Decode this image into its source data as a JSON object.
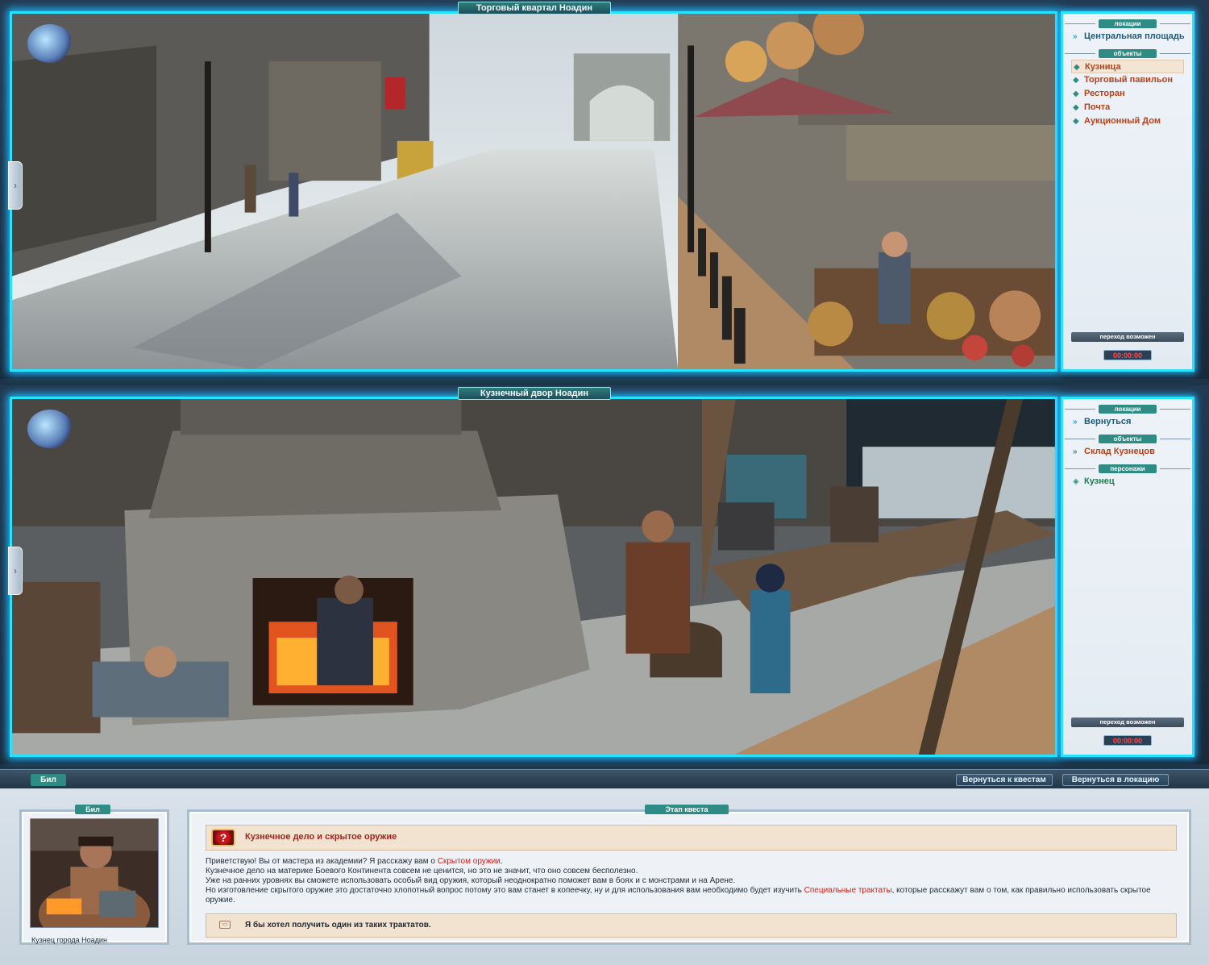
{
  "locations": [
    {
      "title": "Торговый квартал Ноадин",
      "sections": [
        {
          "label": "локации",
          "kind": "loc",
          "items": [
            "Центральная площадь"
          ]
        },
        {
          "label": "объекты",
          "kind": "obj",
          "items": [
            "Кузница",
            "Торговый павильон",
            "Ресторан",
            "Почта",
            "Аукционный Дом"
          ]
        }
      ],
      "transit": "переход возможен",
      "timer": "00:00:00"
    },
    {
      "title": "Кузнечный двор Ноадин",
      "sections": [
        {
          "label": "локации",
          "kind": "loc",
          "items": [
            "Вернуться"
          ]
        },
        {
          "label": "объекты",
          "kind": "obj",
          "items": [
            "Склад Кузнецов"
          ]
        },
        {
          "label": "персонажи",
          "kind": "npc",
          "items": [
            "Кузнец"
          ]
        }
      ],
      "transit": "переход возможен",
      "timer": "00:00:00"
    }
  ],
  "dialog": {
    "npc_tab": "Бил",
    "back_to_quests": "Вернуться к квестам",
    "back_to_location": "Вернуться в локацию",
    "portrait_label": "Бил",
    "portrait_caption": "Кузнец города Ноадин",
    "stage_label": "Этап квеста",
    "quest_title": "Кузнечное дело и скрытое оружие",
    "text": {
      "l1_a": "Приветствую! Вы от мастера из академии? Я расскажу вам о ",
      "l1_hl": "Скрытом оружии",
      "l1_b": ".",
      "l2": "Кузнечное дело на материке Боевого Континента совсем не ценится, но это не значит, что оно совсем бесполезно.",
      "l3": "Уже на ранних уровнях вы сможете использовать особый вид оружия, который неоднократно поможет вам в боях и с монстрами и на Арене.",
      "l4_a": "Но изготовление скрытого оружие это достаточно хлопотный вопрос потому это вам станет в копеечку, ну и для использования вам необходимо будет изучить ",
      "l4_hl": "Специальные трактаты",
      "l4_b": ", которые расскажут вам о том, как правильно использовать скрытое оружие."
    },
    "answer": "Я бы хотел получить один из таких трактатов."
  }
}
